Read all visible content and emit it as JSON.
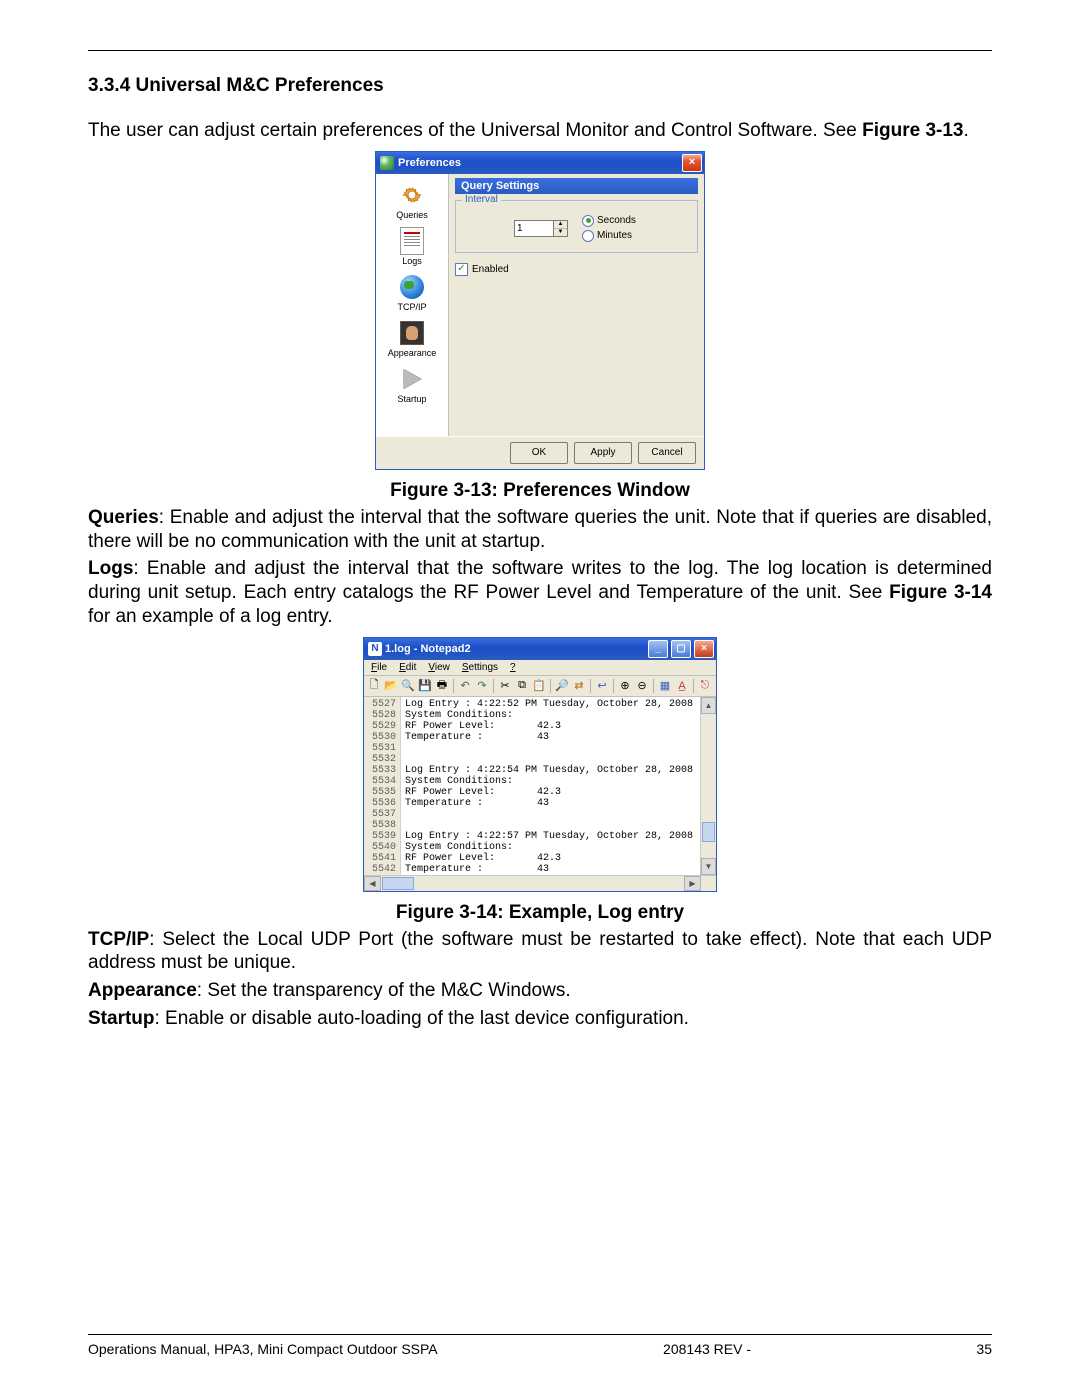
{
  "section_heading": "3.3.4 Universal M&C Preferences",
  "intro_line1": "The user can adjust certain preferences of the Universal Monitor and Control Software. See ",
  "intro_fig_ref": "Figure 3-13",
  "fig1_caption": "Figure 3-13: Preferences Window",
  "queries_bold": "Queries",
  "queries_text": ": Enable and adjust the interval that the software queries the unit. Note that if queries are disabled, there will be no communication with the unit at startup.",
  "logs_bold": "Logs",
  "logs_text": ": Enable and adjust the interval that the software writes to the log. The log location is determined during unit setup. Each entry catalogs the RF Power Level and Temperature of the unit. See ",
  "logs_fig_ref": "Figure 3-14",
  "logs_tail": " for an example of a log entry.",
  "fig2_caption": "Figure 3-14: Example, Log entry",
  "tcpip_bold": "TCP/IP",
  "tcpip_text": ": Select the Local UDP Port (the software must be restarted to take effect). Note that each UDP address must be unique.",
  "appearance_bold": "Appearance",
  "appearance_text": ": Set the transparency of the M&C Windows.",
  "startup_bold": "Startup",
  "startup_text": ": Enable or disable auto-loading of the last device configuration.",
  "footer_left": "Operations Manual, HPA3, Mini Compact Outdoor SSPA",
  "footer_center": "208143 REV -",
  "footer_right": "35",
  "pref_window": {
    "title": "Preferences",
    "sidebar": [
      {
        "label": "Queries"
      },
      {
        "label": "Logs"
      },
      {
        "label": "TCP/IP"
      },
      {
        "label": "Appearance"
      },
      {
        "label": "Startup"
      }
    ],
    "panel_heading": "Query Settings",
    "fieldset_legend": "Interval",
    "interval_value": "1",
    "radio_seconds": "Seconds",
    "radio_minutes": "Minutes",
    "enabled_label": "Enabled",
    "btn_ok": "OK",
    "btn_apply": "Apply",
    "btn_cancel": "Cancel"
  },
  "notepad": {
    "title": "1.log - Notepad2",
    "menus": {
      "file": "File",
      "edit": "Edit",
      "view": "View",
      "settings": "Settings",
      "help": "?"
    },
    "line_start": 5527,
    "lines": [
      "Log Entry : 4:22:52 PM Tuesday, October 28, 2008",
      "System Conditions:",
      "RF Power Level:       42.3",
      "Temperature :         43",
      "",
      "",
      "Log Entry : 4:22:54 PM Tuesday, October 28, 2008",
      "System Conditions:",
      "RF Power Level:       42.3",
      "Temperature :         43",
      "",
      "",
      "Log Entry : 4:22:57 PM Tuesday, October 28, 2008",
      "System Conditions:",
      "RF Power Level:       42.3",
      "Temperature :         43"
    ]
  }
}
